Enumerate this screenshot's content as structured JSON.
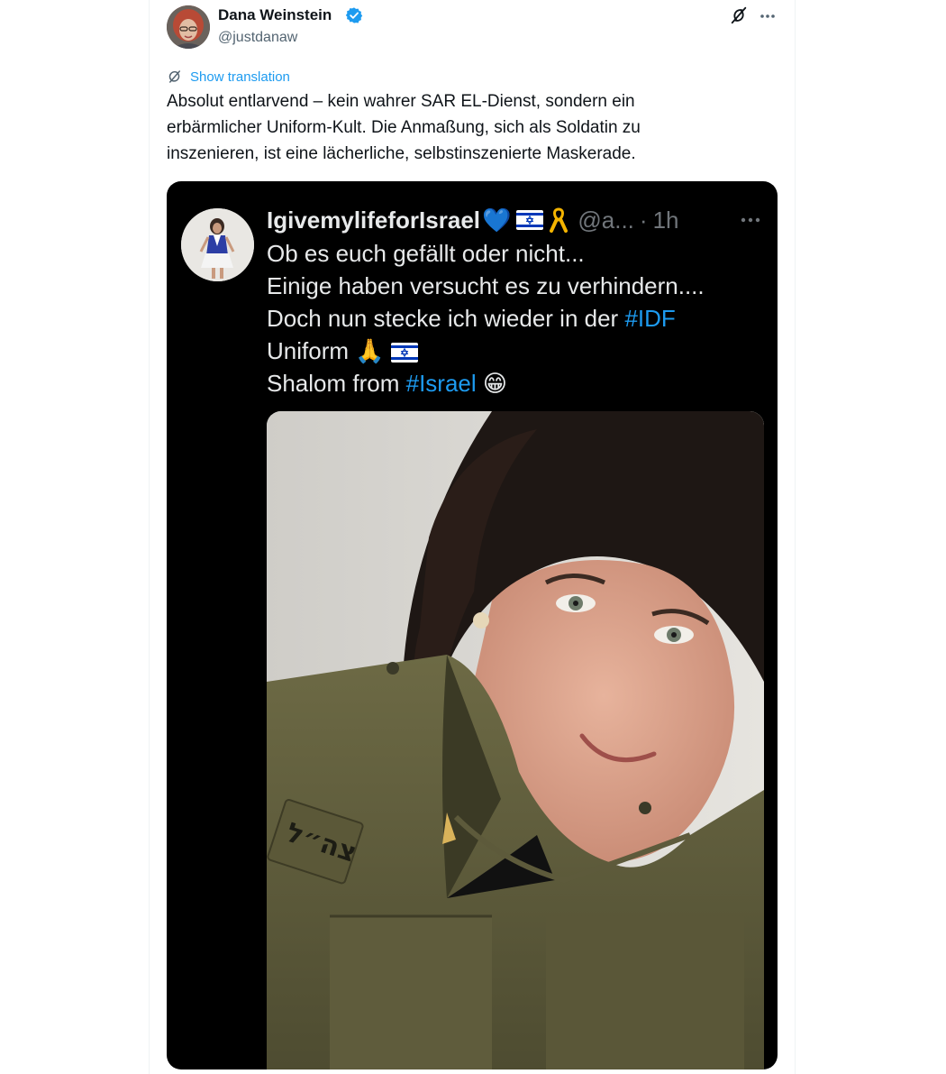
{
  "tweet": {
    "author": {
      "name": "Dana Weinstein",
      "handle": "@justdanaw",
      "verified": true
    },
    "show_translation_label": "Show translation",
    "text_lines": [
      "Absolut entlarvend – kein wahrer SAR EL-Dienst, sondern ein",
      "erbärmlicher Uniform-Kult. Die Anmaßung, sich als Soldatin zu",
      "inszenieren, ist eine lächerliche, selbstinszenierte Maskerade."
    ],
    "icons": {
      "grok": "grok-icon",
      "more": "more-icon",
      "translation": "translate-icon",
      "verified": "verified-badge-icon"
    }
  },
  "quoted_post": {
    "name": "IgivemylifeforIsrael",
    "name_emoji": "💙",
    "handle": "@a...",
    "separator": "·",
    "time": "1h",
    "lines": {
      "l1": "Ob es euch gefällt oder nicht...",
      "l2": "Einige haben versucht es zu verhindern....",
      "l3_text": "Doch nun stecke ich wieder in der ",
      "l3_tag": "#IDF",
      "l4_text": "Uniform 🙏",
      "l5_text": "Shalom from ",
      "l5_tag": "#Israel",
      "l5_emoji": "😁"
    },
    "media_description_icon": "photo"
  },
  "colors": {
    "accent": "#1d9bf0",
    "text_primary": "#0f1419",
    "text_secondary": "#536471",
    "embed_bg": "#000000",
    "embed_text": "#e7e9ea",
    "embed_muted": "#71767b"
  }
}
